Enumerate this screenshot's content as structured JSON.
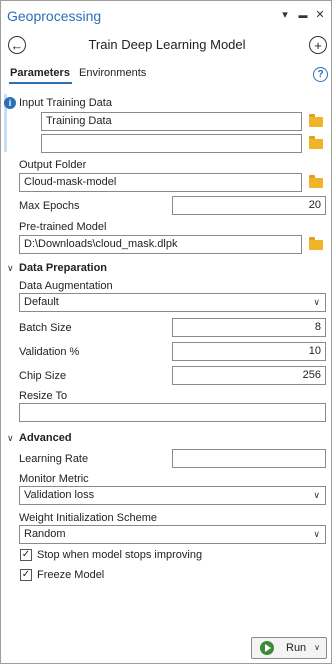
{
  "pane": {
    "title": "Geoprocessing",
    "controls": {
      "dropdown": "▾",
      "pin": "▬",
      "close": "✕"
    }
  },
  "tool": {
    "title": "Train Deep Learning Model",
    "back_glyph": "←",
    "add_glyph": "+"
  },
  "tabs": [
    {
      "label": "Parameters"
    },
    {
      "label": "Environments"
    }
  ],
  "help_glyph": "?",
  "params": {
    "input_training_data": {
      "label": "Input Training Data",
      "values": [
        "Training Data",
        ""
      ]
    },
    "output_folder": {
      "label": "Output Folder",
      "value": "Cloud-mask-model"
    },
    "max_epochs": {
      "label": "Max Epochs",
      "value": "20"
    },
    "pretrained_model": {
      "label": "Pre-trained Model",
      "value": "D:\\Downloads\\cloud_mask.dlpk"
    }
  },
  "data_preparation": {
    "heading": "Data Preparation",
    "data_augmentation": {
      "label": "Data Augmentation",
      "value": "Default"
    },
    "batch_size": {
      "label": "Batch Size",
      "value": "8"
    },
    "validation": {
      "label": "Validation %",
      "value": "10"
    },
    "chip_size": {
      "label": "Chip Size",
      "value": "256"
    },
    "resize_to": {
      "label": "Resize To",
      "value": ""
    }
  },
  "advanced": {
    "heading": "Advanced",
    "learning_rate": {
      "label": "Learning Rate",
      "value": ""
    },
    "monitor_metric": {
      "label": "Monitor Metric",
      "value": "Validation loss"
    },
    "weight_init": {
      "label": "Weight Initialization Scheme",
      "value": "Random"
    },
    "stop_improving": {
      "label": "Stop when model stops improving",
      "checked": true
    },
    "freeze_model": {
      "label": "Freeze Model",
      "checked": true
    }
  },
  "run": {
    "label": "Run"
  },
  "icons": {
    "folder": "folder-icon",
    "info": "info-icon",
    "chevron": "chevron-down-icon"
  },
  "colors": {
    "accent": "#2b6fb6",
    "folder": "#f0b429",
    "run_green": "#3a8a3a"
  }
}
